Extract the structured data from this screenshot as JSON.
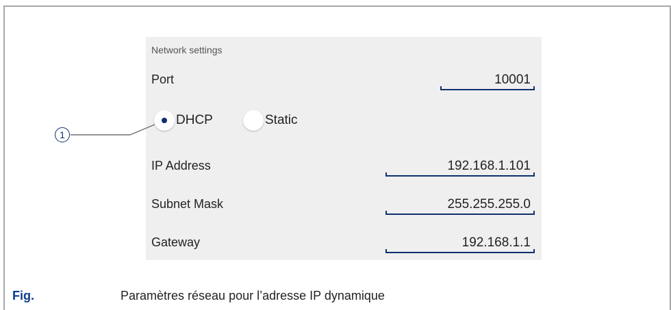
{
  "panel": {
    "section_title": "Network settings",
    "port": {
      "label": "Port",
      "value": "10001"
    },
    "mode": {
      "options": [
        {
          "label": "DHCP",
          "selected": true
        },
        {
          "label": "Static",
          "selected": false
        }
      ]
    },
    "ip_address": {
      "label": "IP Address",
      "value": "192.168.1.101"
    },
    "subnet_mask": {
      "label": "Subnet Mask",
      "value": "255.255.255.0"
    },
    "gateway": {
      "label": "Gateway",
      "value": "192.168.1.1"
    }
  },
  "callout": {
    "number": "1"
  },
  "caption": {
    "fig_label": "Fig.",
    "text": "Paramètres réseau pour l’adresse IP dynamique"
  },
  "colors": {
    "accent": "#0e2f6e",
    "caption_accent": "#0c3b8e",
    "panel_bg": "#efefef",
    "frame": "#a7a7a7"
  }
}
